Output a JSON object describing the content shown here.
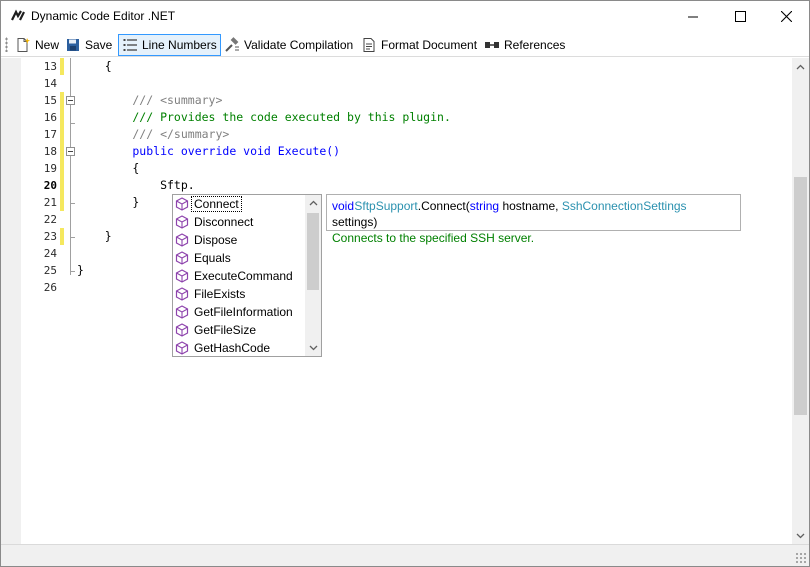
{
  "window": {
    "title": "Dynamic Code Editor .NET",
    "icons": [
      "app-icon",
      "minimize-icon",
      "maximize-icon",
      "close-icon"
    ]
  },
  "toolbar": {
    "new_label": "New",
    "save_label": "Save",
    "line_numbers_label": "Line Numbers",
    "validate_label": "Validate Compilation",
    "format_label": "Format Document",
    "references_label": "References"
  },
  "editor": {
    "lines": [
      {
        "number": "13",
        "code": "    {"
      },
      {
        "number": "14",
        "code": ""
      },
      {
        "number": "15",
        "code": "        /// <summary>"
      },
      {
        "number": "16",
        "code": "        /// Provides the code executed by this plugin."
      },
      {
        "number": "17",
        "code": "        /// </summary>"
      },
      {
        "number": "18",
        "code": "        public override void Execute()"
      },
      {
        "number": "19",
        "code": "        {"
      },
      {
        "number": "20",
        "code": "            Sftp."
      },
      {
        "number": "21",
        "code": "        }"
      },
      {
        "number": "22",
        "code": ""
      },
      {
        "number": "23",
        "code": "    }"
      },
      {
        "number": "24",
        "code": ""
      },
      {
        "number": "25",
        "code": "}"
      },
      {
        "number": "26",
        "code": ""
      }
    ],
    "current_line": "20"
  },
  "completion": {
    "items": [
      "Connect",
      "Disconnect",
      "Dispose",
      "Equals",
      "ExecuteCommand",
      "FileExists",
      "GetFileInformation",
      "GetFileSize",
      "GetHashCode"
    ],
    "selected": "Connect",
    "item_icon": "method-cube-icon",
    "colors": {
      "method_icon": "#8e44ad"
    }
  },
  "tooltip": {
    "return_type": "void",
    "class_name": "SftpSupport",
    "method": ".Connect(",
    "param1_type": "string",
    "param1_name": " hostname, ",
    "param2_type": "SshConnectionSettings",
    "param2_name": " settings)",
    "description": "Connects to the specified SSH server.",
    "colors": {
      "keyword": "#0000ff",
      "type": "#2b91af",
      "description": "#008000"
    }
  }
}
